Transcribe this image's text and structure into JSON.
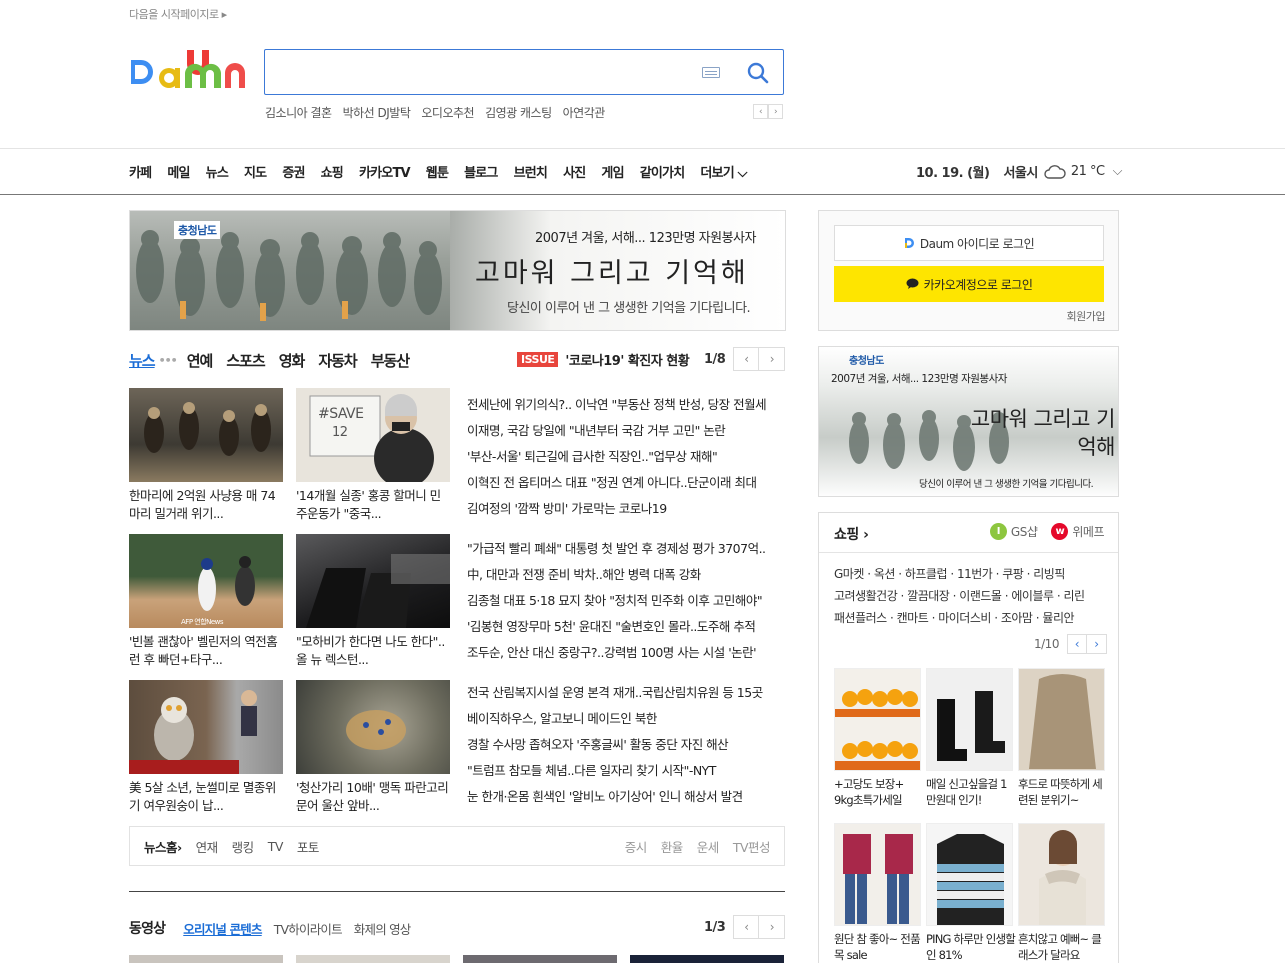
{
  "header": {
    "start_page_link": "다음을 시작페이지로 ▸",
    "search": {
      "value": "",
      "placeholder": ""
    },
    "hot_keywords": [
      "김소니아 결혼",
      "박하선 DJ발탁",
      "오디오추천",
      "김영광 캐스팅",
      "아연각관"
    ],
    "hot_prev": "‹",
    "hot_next": "›"
  },
  "gnb": {
    "items": [
      "카페",
      "메일",
      "뉴스",
      "지도",
      "증권",
      "쇼핑",
      "카카오TV",
      "웹툰",
      "블로그",
      "브런치",
      "사진",
      "게임",
      "같이가치",
      "더보기 ⌵"
    ],
    "date": "10. 19. (월)",
    "city": "서울시",
    "temp": "21 °C",
    "weather_toggle": "⌵"
  },
  "banner_main": {
    "brand": "충청남도",
    "line1": "2007년 겨울, 서해... 123만명 자원봉사자",
    "line2": "고마워 그리고 기억해",
    "line3": "당신이 이루어 낸 그 생생한 기억을 기다립니다."
  },
  "news": {
    "tabs": [
      "뉴스",
      "연예",
      "스포츠",
      "영화",
      "자동차",
      "부동산"
    ],
    "tab_dots": "•••",
    "issue_badge": "ISSUE",
    "issue_text": "'코로나19' 확진자 현황",
    "page": "1/8",
    "prev": "‹",
    "next": "›",
    "thumbs": [
      {
        "caption": "한마리에 2억원 사냥용 매 74마리 밀거래 위기..."
      },
      {
        "caption": "'14개월 실종' 홍콩 할머니 민주운동가 \"중국..."
      },
      {
        "caption": "'빈볼 괜찮아' 벨린저의 역전홈런 후 빠던+타구..."
      },
      {
        "caption": "\"모하비가 한다면 나도 한다\"..올 뉴 렉스턴..."
      },
      {
        "caption": "美 5살 소년, 눈썰미로 멸종위기 여우원숭이 납..."
      },
      {
        "caption": "'청산가리 10배' 맹독 파란고리문어 울산 앞바..."
      }
    ],
    "headlines": [
      "전세난에 위기의식?.. 이낙연 \"부동산 정책 반성, 당장 전월세",
      "이재명, 국감 당일에 \"내년부터 국감 거부 고민\" 논란",
      "'부산-서울' 퇴근길에 급사한 직장인..\"업무상 재해\"",
      "이혁진 전 옵티머스 대표 \"정권 연계 아니다..단군이래 최대",
      "김여정의 '깜짝 방미' 가로막는 코로나19",
      "\"가급적 빨리 폐쇄\" 대통령 첫 발언 후 경제성 평가 3707억..",
      "中, 대만과 전쟁 준비 박차..해안 병력 대폭 강화",
      "김종철 대표 5·18 묘지 찾아 \"정치적 민주화 이후 고민해야\"",
      "'김봉현 영장무마 5천' 윤대진 \"술변호인 몰라..도주해 추적",
      "조두순, 안산 대신 중랑구?..강력범 100명 사는 시설 '논란'",
      "전국 산림복지시설 운영 본격 재개..국립산림치유원 등 15곳",
      "베이직하우스, 알고보니 메이드인 북한",
      "경찰 수사망 좁혀오자 '주홍글씨' 활동 중단 자진 해산",
      "\"트럼프 참모들 체념..다른 일자리 찾기 시작\"-NYT",
      "눈 한개·온몸 흰색인 '알비노 아기상어' 인니 해상서 발견"
    ],
    "footer_links": [
      "뉴스홈›",
      "연재",
      "랭킹",
      "TV",
      "포토"
    ],
    "footer_right": [
      "증시",
      "환율",
      "운세",
      "TV편성"
    ]
  },
  "video": {
    "title": "동영상",
    "tabs": [
      "오리지널 콘텐츠",
      "TV하이라이트",
      "화제의 영상"
    ],
    "page": "1/3",
    "prev": "‹",
    "next": "›"
  },
  "login": {
    "daum_label": "Daum 아이디로 로그인",
    "kakao_label": "카카오계정으로 로그인",
    "join": "회원가입"
  },
  "banner_side": {
    "brand": "충청남도",
    "line1": "2007년 겨울, 서해... 123만명 자원봉사자",
    "line2": "고마워 그리고 기억해",
    "line3": "당신이 이루어 낸 그 생생한 기억을 기다립니다."
  },
  "shopping": {
    "title": "쇼핑 ›",
    "partner1": "GS샵",
    "partner2": "위메프",
    "links_row1": "G마켓 · 옥션 · 하프클럽 · 11번가 · 쿠팡 · 리빙픽",
    "links_row2": "고려생활건강 · 깔끔대장 · 이랜드몰 · 에이블루 · 리린",
    "links_row3": "패션플러스 · 캔마트 · 마이더스비 · 조아맘 · 뮬리안",
    "page": "1/10",
    "prev": "‹",
    "next": "›",
    "products": [
      {
        "caption": "+고당도 보장+ 9kg초특가세일"
      },
      {
        "caption": "매일 신고싶을걸 1만원대 인기!"
      },
      {
        "caption": "후드로 따뜻하게 세련된 분위기~"
      },
      {
        "caption": "원단 참 좋아~ 전품목 sale"
      },
      {
        "caption": "PING 하루만 인생할인 81%"
      },
      {
        "caption": "흔치않고 예뻐~ 클래스가 달라요"
      }
    ]
  },
  "colors": {
    "accent": "#1b6dd6",
    "issue": "#e8453c",
    "kakao": "#fee500",
    "search_border": "#3c79d7"
  }
}
